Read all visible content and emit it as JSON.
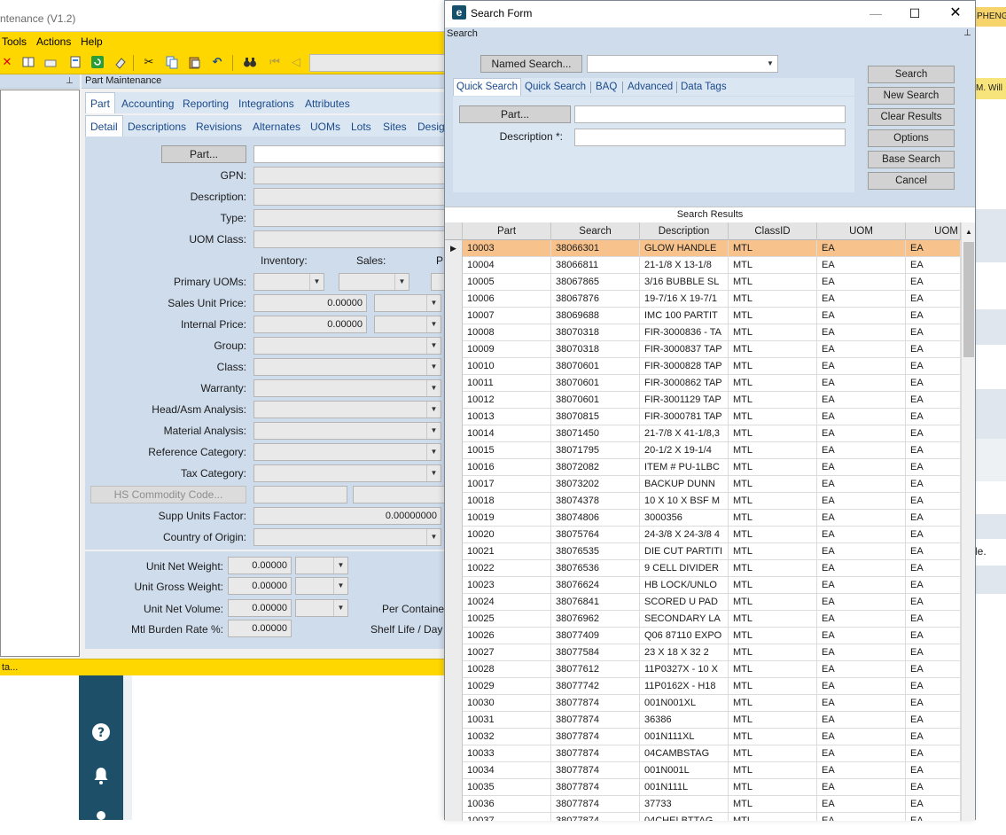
{
  "part_maintenance": {
    "title": "ntenance (V1.2)",
    "menu": [
      "Tools",
      "Actions",
      "Help"
    ],
    "panel_header": "Part Maintenance",
    "tabs_primary": [
      "Part",
      "Accounting",
      "Reporting",
      "Integrations",
      "Attributes"
    ],
    "tabs_secondary": [
      "Detail",
      "Descriptions",
      "Revisions",
      "Alternates",
      "UOMs",
      "Lots",
      "Sites",
      "Desig"
    ],
    "fields": {
      "part_button": "Part...",
      "gpn": "GPN:",
      "description": "Description:",
      "type": "Type:",
      "uom_class": "UOM Class:",
      "inventory": "Inventory:",
      "sales": "Sales:",
      "purchasing_partial": "P",
      "primary_uoms": "Primary UOMs:",
      "sales_unit_price": "Sales Unit Price:",
      "sales_unit_price_value": "0.00000",
      "internal_price": "Internal Price:",
      "internal_price_value": "0.00000",
      "group": "Group:",
      "class": "Class:",
      "warranty": "Warranty:",
      "head_asm": "Head/Asm Analysis:",
      "material_analysis": "Material Analysis:",
      "reference_category": "Reference Category:",
      "tax_category": "Tax Category:",
      "hs_commodity": "HS Commodity Code...",
      "supp_units_factor": "Supp Units Factor:",
      "supp_units_factor_value": "0.00000000",
      "country_of_origin": "Country of Origin:",
      "unit_net_weight": "Unit Net Weight:",
      "unit_net_weight_value": "0.00000",
      "unit_gross_weight": "Unit Gross Weight:",
      "unit_gross_weight_value": "0.00000",
      "unit_net_volume": "Unit Net Volume:",
      "unit_net_volume_value": "0.00000",
      "mtl_burden_rate": "Mtl Burden Rate %:",
      "mtl_burden_rate_value": "0.00000",
      "per_container": "Per Containe",
      "shelf_life": "Shelf Life / Day"
    },
    "status": "ta..."
  },
  "right_strip": {
    "top_label": "PHENG",
    "user_label": "M. Will",
    "text_partial": "le."
  },
  "search_form": {
    "title": "Search Form",
    "section_header": "Search",
    "named_search_button": "Named Search...",
    "tabs": [
      "Quick Search",
      "Quick Search",
      "BAQ",
      "Advanced",
      "Data Tags"
    ],
    "part_button": "Part...",
    "description_label": "Description *:",
    "buttons": [
      "Search",
      "New Search",
      "Clear Results",
      "Options",
      "Base Search",
      "Cancel"
    ],
    "results_header": "Search Results",
    "columns": [
      "Part",
      "Search",
      "Description",
      "ClassID",
      "UOM",
      "UOM"
    ],
    "rows": [
      [
        "10003",
        "38066301",
        "GLOW HANDLE",
        "MTL",
        "EA",
        "EA"
      ],
      [
        "10004",
        "38066811",
        "21-1/8 X 13-1/8",
        "MTL",
        "EA",
        "EA"
      ],
      [
        "10005",
        "38067865",
        "3/16 BUBBLE SL",
        "MTL",
        "EA",
        "EA"
      ],
      [
        "10006",
        "38067876",
        "19-7/16 X 19-7/1",
        "MTL",
        "EA",
        "EA"
      ],
      [
        "10007",
        "38069688",
        "IMC 100 PARTIT",
        "MTL",
        "EA",
        "EA"
      ],
      [
        "10008",
        "38070318",
        "FIR-3000836 - TA",
        "MTL",
        "EA",
        "EA"
      ],
      [
        "10009",
        "38070318",
        "FIR-3000837 TAP",
        "MTL",
        "EA",
        "EA"
      ],
      [
        "10010",
        "38070601",
        "FIR-3000828 TAP",
        "MTL",
        "EA",
        "EA"
      ],
      [
        "10011",
        "38070601",
        "FIR-3000862 TAP",
        "MTL",
        "EA",
        "EA"
      ],
      [
        "10012",
        "38070601",
        "FIR-3001129 TAP",
        "MTL",
        "EA",
        "EA"
      ],
      [
        "10013",
        "38070815",
        "FIR-3000781 TAP",
        "MTL",
        "EA",
        "EA"
      ],
      [
        "10014",
        "38071450",
        "21-7/8 X 41-1/8,3",
        "MTL",
        "EA",
        "EA"
      ],
      [
        "10015",
        "38071795",
        "20-1/2 X 19-1/4",
        "MTL",
        "EA",
        "EA"
      ],
      [
        "10016",
        "38072082",
        "ITEM # PU-1LBC",
        "MTL",
        "EA",
        "EA"
      ],
      [
        "10017",
        "38073202",
        "BACKUP DUNN",
        "MTL",
        "EA",
        "EA"
      ],
      [
        "10018",
        "38074378",
        "10 X 10 X BSF M",
        "MTL",
        "EA",
        "EA"
      ],
      [
        "10019",
        "38074806",
        "3000356",
        "MTL",
        "EA",
        "EA"
      ],
      [
        "10020",
        "38075764",
        "24-3/8 X 24-3/8 4",
        "MTL",
        "EA",
        "EA"
      ],
      [
        "10021",
        "38076535",
        "DIE CUT PARTITI",
        "MTL",
        "EA",
        "EA"
      ],
      [
        "10022",
        "38076536",
        "9 CELL DIVIDER",
        "MTL",
        "EA",
        "EA"
      ],
      [
        "10023",
        "38076624",
        "HB LOCK/UNLO",
        "MTL",
        "EA",
        "EA"
      ],
      [
        "10024",
        "38076841",
        "SCORED U PAD",
        "MTL",
        "EA",
        "EA"
      ],
      [
        "10025",
        "38076962",
        "SECONDARY LA",
        "MTL",
        "EA",
        "EA"
      ],
      [
        "10026",
        "38077409",
        "Q06 87110 EXPO",
        "MTL",
        "EA",
        "EA"
      ],
      [
        "10027",
        "38077584",
        "23 X 18 X 32   2",
        "MTL",
        "EA",
        "EA"
      ],
      [
        "10028",
        "38077612",
        "11P0327X - 10 X",
        "MTL",
        "EA",
        "EA"
      ],
      [
        "10029",
        "38077742",
        "11P0162X -  H18",
        "MTL",
        "EA",
        "EA"
      ],
      [
        "10030",
        "38077874",
        "001N001XL",
        "MTL",
        "EA",
        "EA"
      ],
      [
        "10031",
        "38077874",
        "36386",
        "MTL",
        "EA",
        "EA"
      ],
      [
        "10032",
        "38077874",
        "001N111XL",
        "MTL",
        "EA",
        "EA"
      ],
      [
        "10033",
        "38077874",
        "04CAMBSTAG",
        "MTL",
        "EA",
        "EA"
      ],
      [
        "10034",
        "38077874",
        "001N001L",
        "MTL",
        "EA",
        "EA"
      ],
      [
        "10035",
        "38077874",
        "001N111L",
        "MTL",
        "EA",
        "EA"
      ],
      [
        "10036",
        "38077874",
        "37733",
        "MTL",
        "EA",
        "EA"
      ],
      [
        "10037",
        "38077874",
        "04CHELBTTAG",
        "MTL",
        "EA",
        "EA"
      ]
    ]
  }
}
